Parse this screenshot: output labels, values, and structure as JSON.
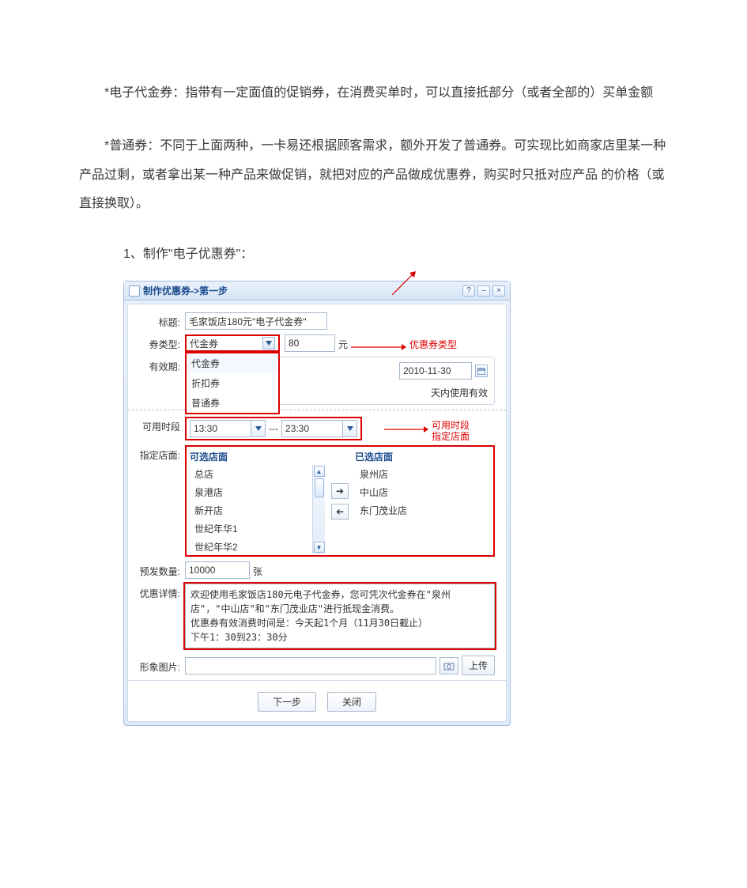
{
  "descriptions": {
    "voucher": "*电子代金券：指带有一定面值的促销券，在消费买单时，可以直接抵部分（或者全部的）买单金额",
    "normal": "*普通券：不同于上面两种，一卡易还根据顾客需求，额外开发了普通券。可实现比如商家店里某一种产品过剩，或者拿出某一种产品来做促销，就把对应的产品做成优惠券，购买时只抵对应产品 的价格（或直接换取）。"
  },
  "section_title": "1、制作\"电子优惠券\"：",
  "dialog": {
    "title": "制作优惠券->第一步",
    "labels": {
      "title": "标题:",
      "type": "券类型:",
      "validity": "有效期:",
      "timeslot": "可用时段",
      "stores": "指定店面:",
      "quantity": "预发数量:",
      "detail": "优惠详情:",
      "image": "形象图片:"
    },
    "title_value": "毛家饭店180元\"电子代金券\"",
    "type_selected": "代金券",
    "type_options": [
      "代金券",
      "折扣券",
      "普通券"
    ],
    "amount": "80",
    "unit_yuan": "元",
    "end_date": "2010-11-30",
    "days_valid_suffix": "天内使用有效",
    "time_from": "13:30",
    "time_sep": "---",
    "time_to": "23:30",
    "available_stores_header": "可选店面",
    "selected_stores_header": "已选店面",
    "available_stores": [
      "总店",
      "泉港店",
      "新开店",
      "世纪年华1",
      "世纪年华2"
    ],
    "selected_stores": [
      "泉州店",
      "中山店",
      "东门茂业店"
    ],
    "quantity_value": "10000",
    "quantity_unit": "张",
    "detail_text": "欢迎使用毛家饭店180元电子代金券，您可凭次代金券在\"泉州店\"，\"中山店\"和\"东门茂业店\"进行抵现金消费。\n优惠券有效消费时间是：今天起1个月（11月30日截止）\n下午1：30到23：30分",
    "btn_next": "下一步",
    "btn_close": "关闭",
    "btn_upload": "上传"
  },
  "annotations": {
    "type": "优惠券类型",
    "timeslot_line1": "可用时段",
    "timeslot_line2": "指定店面"
  }
}
